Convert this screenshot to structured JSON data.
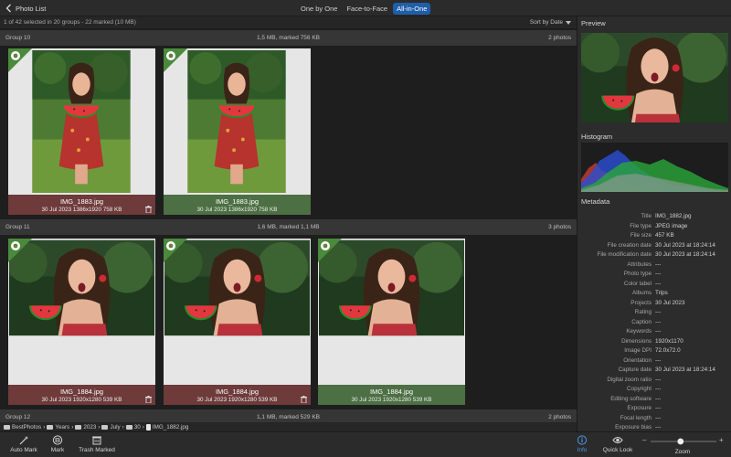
{
  "topbar": {
    "back_label": "Photo List",
    "tabs": [
      {
        "label": "One by One",
        "active": false
      },
      {
        "label": "Face-to-Face",
        "active": false
      },
      {
        "label": "All-in-One",
        "active": true
      }
    ]
  },
  "status": {
    "selection": "1 of 42 selected in 20 groups - 22 marked (10 MB)",
    "sort_label": "Sort by Date"
  },
  "groups": [
    {
      "name": "Group 10",
      "info": "1,5 MB, marked 756 KB",
      "count": "2 photos"
    },
    {
      "name": "Group 11",
      "info": "1,6 MB, marked 1,1 MB",
      "count": "3 photos"
    },
    {
      "name": "Group 12",
      "info": "1,1 MB, marked 529 KB",
      "count": "2 photos"
    }
  ],
  "cards": [
    {
      "filename": "IMG_1883.jpg",
      "meta": "30 Jul 2023  1386x1920  758 KB",
      "status": "marked"
    },
    {
      "filename": "IMG_1883.jpg",
      "meta": "30 Jul 2023  1386x1920  758 KB",
      "status": "kept"
    },
    {
      "filename": "IMG_1884.jpg",
      "meta": "30 Jul 2023  1920x1280  539 KB",
      "status": "marked"
    },
    {
      "filename": "IMG_1884.jpg",
      "meta": "30 Jul 2023  1920x1280  539 KB",
      "status": "marked"
    },
    {
      "filename": "IMG_1884.jpg",
      "meta": "30 Jul 2023  1920x1280  539 KB",
      "status": "kept"
    }
  ],
  "path": [
    "BestPhotos",
    "Years",
    "2023",
    "July",
    "30",
    "IMG_1882.jpg"
  ],
  "bottom": {
    "auto_mark": "Auto Mark",
    "mark": "Mark",
    "trash_marked": "Trash Marked",
    "info": "Info",
    "quick_look": "Quick Look",
    "zoom": "Zoom",
    "zoom_minus": "–",
    "zoom_plus": "+",
    "zoom_level": 0.45
  },
  "sidebar": {
    "preview_title": "Preview",
    "histogram_title": "Histogram",
    "metadata_title": "Metadata",
    "metadata": [
      {
        "key": "Title",
        "value": "IMG_1882.jpg"
      },
      {
        "key": "File type",
        "value": "JPEG image"
      },
      {
        "key": "File size",
        "value": "457 KB"
      },
      {
        "key": "File creation date",
        "value": "30 Jul 2023 at 18:24:14"
      },
      {
        "key": "File modification date",
        "value": "30 Jul 2023 at 18:24:14"
      },
      {
        "key": "Attributes",
        "value": "---"
      },
      {
        "key": "Photo type",
        "value": "---"
      },
      {
        "key": "Color label",
        "value": "---"
      },
      {
        "key": "Albums",
        "value": "Trips"
      },
      {
        "key": "Projects",
        "value": "30 Jul 2023"
      },
      {
        "key": "Rating",
        "value": "---"
      },
      {
        "key": "Caption",
        "value": "---"
      },
      {
        "key": "Keywords",
        "value": "---"
      },
      {
        "key": "Dimensions",
        "value": "1920x1170"
      },
      {
        "key": "Image DPI",
        "value": "72.0x72.0"
      },
      {
        "key": "Orientation",
        "value": "---"
      },
      {
        "key": "Capture date",
        "value": "30 Jul 2023 at 18:24:14"
      },
      {
        "key": "Digital zoom ratio",
        "value": "---"
      },
      {
        "key": "Copyright",
        "value": "---"
      },
      {
        "key": "Editing software",
        "value": "---"
      },
      {
        "key": "Exposure",
        "value": "---"
      },
      {
        "key": "Focal length",
        "value": "---"
      },
      {
        "key": "Exposure bias",
        "value": "---"
      }
    ]
  },
  "colors": {
    "accent": "#1f5ea8",
    "marked": "#6e3a3a",
    "kept": "#4c6f43"
  }
}
